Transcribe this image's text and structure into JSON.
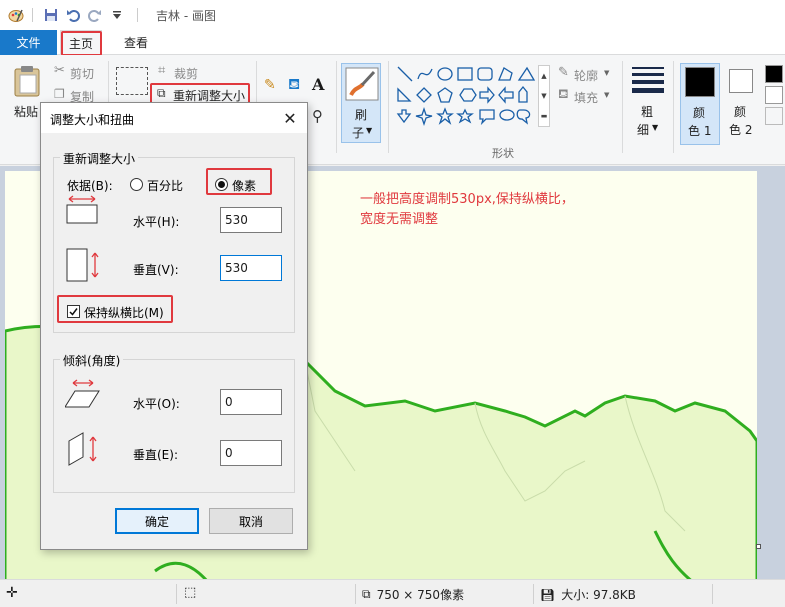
{
  "window": {
    "title": "吉林 - 画图"
  },
  "menu": {
    "file": "文件",
    "home": "主页",
    "view": "查看"
  },
  "ribbon": {
    "paste": "粘贴",
    "cut": "剪切",
    "copy": "复制",
    "crop": "裁剪",
    "resize": "重新调整大小",
    "brushes_top": "刷",
    "brushes_bottom": "子",
    "outline": "轮廓",
    "fill": "填充",
    "shapes_group": "形状",
    "size_top": "粗",
    "size_bottom": "细",
    "color1_top": "颜",
    "color1_bottom": "色 1",
    "color2_top": "颜",
    "color2_bottom": "色 2",
    "text_tool": "A"
  },
  "dialog": {
    "title": "调整大小和扭曲",
    "resize_group": "重新调整大小",
    "by_label": "依据(B):",
    "percent_option": "百分比",
    "pixels_option": "像素",
    "horizontal_label": "水平(H):",
    "horizontal_value": "530",
    "vertical_label": "垂直(V):",
    "vertical_value": "530",
    "keep_ratio_label": "保持纵横比(M)",
    "skew_group": "倾斜(角度)",
    "skew_h_label": "水平(O):",
    "skew_h_value": "0",
    "skew_v_label": "垂直(E):",
    "skew_v_value": "0",
    "ok": "确定",
    "cancel": "取消"
  },
  "annotation": {
    "line1": "一般把高度调制530px,保持纵横比，",
    "line2": "宽度无需调整"
  },
  "status": {
    "dimensions": "750 × 750像素",
    "file_size": "大小: 97.8KB"
  },
  "colors": {
    "accent": "#1979ca",
    "highlight": "#e0393e",
    "map_border": "#2fae1f",
    "map_fill": "#e9f7c9",
    "canvas_bg": "#fdffef"
  }
}
